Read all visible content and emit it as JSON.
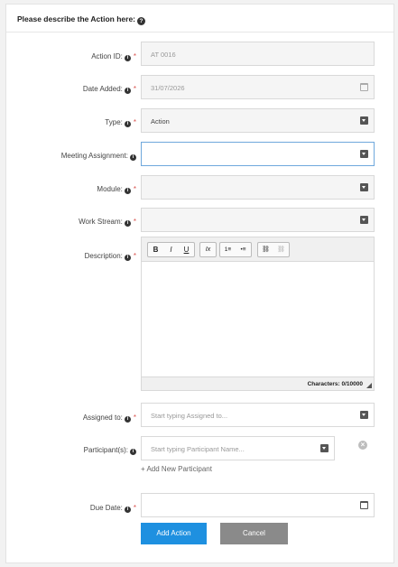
{
  "header": {
    "title": "Please describe the Action here:"
  },
  "fields": {
    "action_id": {
      "label": "Action ID:",
      "value": "AT 0016"
    },
    "date_added": {
      "label": "Date Added:",
      "value": "31/07/2026"
    },
    "type": {
      "label": "Type:",
      "value": "Action"
    },
    "meeting_assignment": {
      "label": "Meeting Assignment:",
      "value": ""
    },
    "module": {
      "label": "Module:",
      "value": ""
    },
    "work_stream": {
      "label": "Work Stream:",
      "value": ""
    },
    "description": {
      "label": "Description:"
    },
    "assigned_to": {
      "label": "Assigned to:",
      "placeholder": "Start typing Assigned to..."
    },
    "participants": {
      "label": "Participant(s):",
      "placeholder": "Start typing Participant Name..."
    },
    "due_date": {
      "label": "Due Date:",
      "value": ""
    }
  },
  "editor": {
    "toolbar": {
      "bold": "B",
      "italic": "I",
      "underline": "U",
      "clear_format": "Ix",
      "ordered_list": "1≡",
      "bullet_list": "•≡",
      "link": "⛓",
      "unlink": "⛓"
    },
    "char_count": "Characters: 0/10000"
  },
  "add_participant_label": "+ Add New Participant",
  "buttons": {
    "submit": "Add Action",
    "cancel": "Cancel"
  },
  "icons": {
    "info": "i",
    "help": "?",
    "required": "*",
    "remove": "×"
  },
  "colors": {
    "primary": "#1e90e0",
    "cancel": "#8a8a8a",
    "required": "#d9534f",
    "focus_border": "#6fa8dc"
  }
}
